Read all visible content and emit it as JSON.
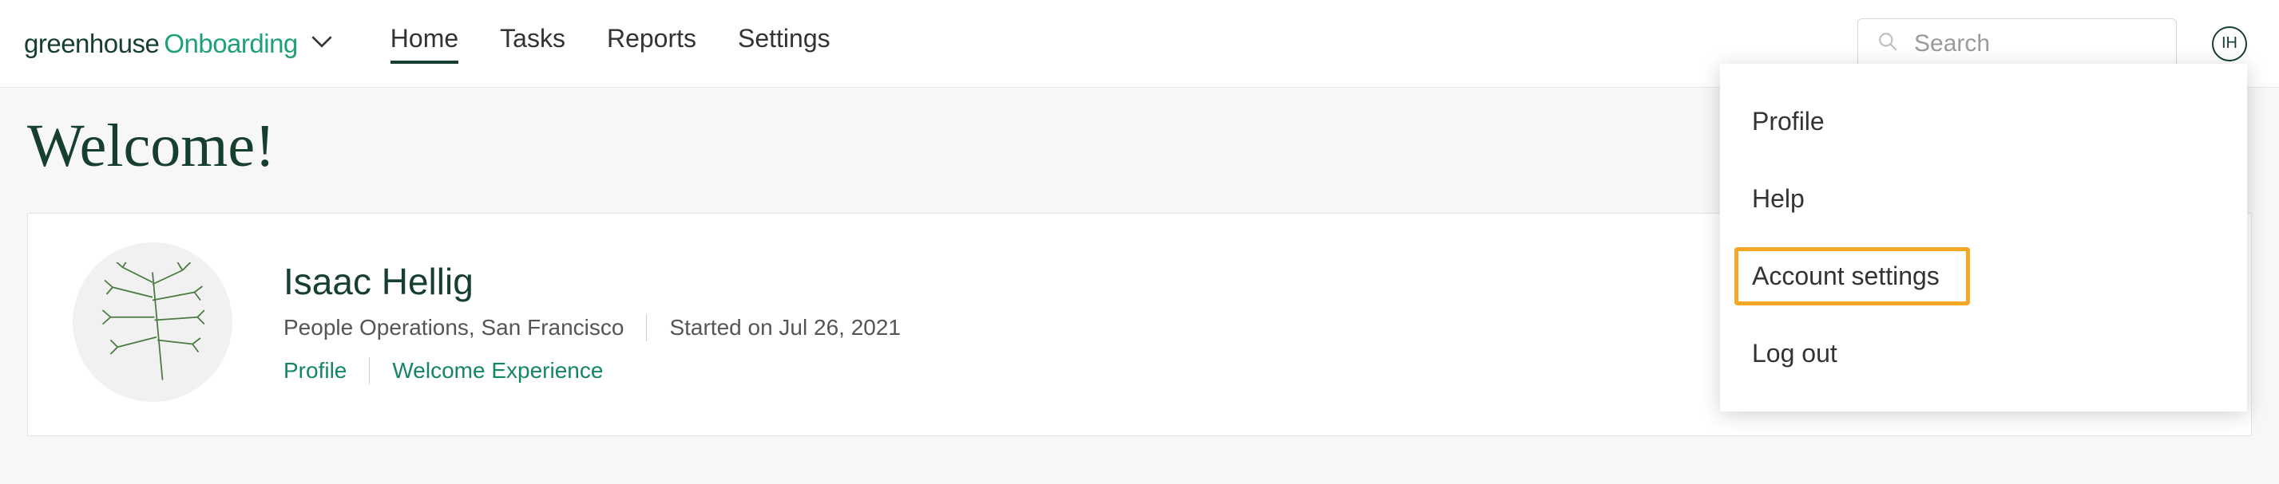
{
  "logo": {
    "part1": "greenhouse",
    "part2": "Onboarding"
  },
  "nav": {
    "items": [
      {
        "label": "Home",
        "active": true
      },
      {
        "label": "Tasks",
        "active": false
      },
      {
        "label": "Reports",
        "active": false
      },
      {
        "label": "Settings",
        "active": false
      }
    ]
  },
  "search": {
    "placeholder": "Search"
  },
  "avatar": {
    "initials": "IH"
  },
  "page": {
    "title": "Welcome!"
  },
  "user_card": {
    "name": "Isaac Hellig",
    "dept_loc": "People Operations, San Francisco",
    "started": "Started on Jul 26, 2021",
    "links": {
      "profile": "Profile",
      "welcome": "Welcome Experience"
    }
  },
  "dropdown": {
    "items": [
      {
        "label": "Profile",
        "highlighted": false
      },
      {
        "label": "Help",
        "highlighted": false
      },
      {
        "label": "Account settings",
        "highlighted": true
      },
      {
        "label": "Log out",
        "highlighted": false
      }
    ]
  }
}
